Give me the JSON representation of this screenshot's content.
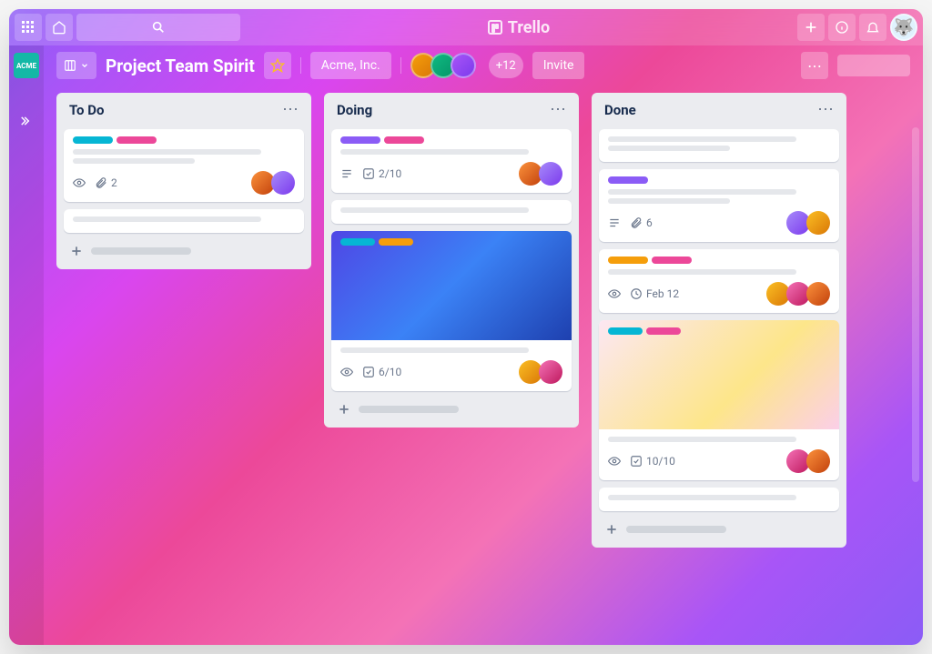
{
  "app": {
    "brand": "Trello"
  },
  "board": {
    "workspace_badge": "ACME",
    "title": "Project Team Spirit",
    "org": "Acme, Inc.",
    "member_overflow": "+12",
    "invite_label": "Invite"
  },
  "labels": {
    "cyan": "#06b6d4",
    "pink": "#ec4899",
    "purple": "#8b5cf6",
    "yellow": "#f59e0b"
  },
  "lists": [
    {
      "title": "To Do",
      "cards": [
        {
          "labels": [
            "cyan",
            "pink"
          ],
          "lines": 2,
          "badges": {
            "watch": true,
            "attachments": "2"
          },
          "members": [
            "m1",
            "m2"
          ]
        },
        {
          "labels": [],
          "lines": 1,
          "badges": {}
        }
      ]
    },
    {
      "title": "Doing",
      "cards": [
        {
          "labels": [
            "purple",
            "pink"
          ],
          "lines": 1,
          "badges": {
            "description": true,
            "checklist": "2/10"
          },
          "members": [
            "m1",
            "m2"
          ]
        },
        {
          "labels": [],
          "lines": 1,
          "badges": {}
        },
        {
          "cover_gradient": "linear-gradient(135deg,#4f46e5 0%,#3b82f6 50%,#1e40af 100%)",
          "labels": [
            "cyan",
            "yellow"
          ],
          "lines": 1,
          "badges": {
            "watch": true,
            "checklist": "6/10"
          },
          "members": [
            "m1",
            "m2"
          ]
        }
      ]
    },
    {
      "title": "Done",
      "cards": [
        {
          "labels": [],
          "lines": 2,
          "badges": {}
        },
        {
          "labels": [
            "purple"
          ],
          "lines": 2,
          "badges": {
            "description": true,
            "attachments": "6"
          },
          "members": [
            "m1",
            "m2"
          ]
        },
        {
          "labels": [
            "yellow",
            "pink"
          ],
          "lines": 1,
          "badges": {
            "watch": true,
            "due": "Feb 12"
          },
          "members": [
            "m1",
            "m2",
            "m3"
          ]
        },
        {
          "cover_gradient": "linear-gradient(135deg,#fce7f3 0%,#fde68a 60%,#fbcfe8 100%)",
          "labels": [
            "cyan",
            "pink"
          ],
          "lines": 1,
          "badges": {
            "watch": true,
            "checklist": "10/10"
          },
          "members": [
            "m1",
            "m2"
          ]
        },
        {
          "labels": [],
          "lines": 1,
          "badges": {}
        }
      ]
    }
  ],
  "avatar_palette": [
    "linear-gradient(135deg,#fb923c,#c2410c)",
    "linear-gradient(135deg,#a78bfa,#7c3aed)",
    "linear-gradient(135deg,#fbbf24,#d97706)",
    "linear-gradient(135deg,#f472b6,#be185d)"
  ]
}
